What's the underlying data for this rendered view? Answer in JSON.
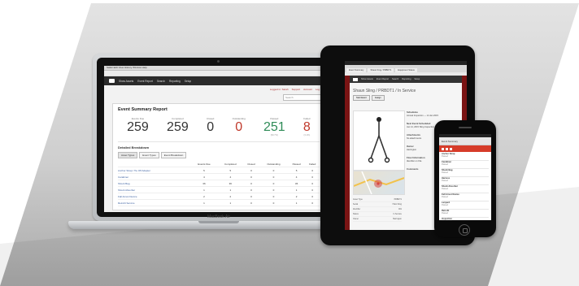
{
  "laptop": {
    "menubar": "Safari  Edit  View  History  Window  Help",
    "nav": {
      "items": [
        "Show Assets",
        "Event Report",
        "Search",
        "Reporting",
        "Setup"
      ]
    },
    "subnav": [
      "Logged in: Sarah",
      "Support",
      "Account",
      "Log out"
    ],
    "search_placeholder": "Search",
    "report": {
      "title": "Event Summary Report",
      "stats": [
        {
          "label": "Events Due",
          "value": "259",
          "note": "",
          "color": "#333333"
        },
        {
          "label": "Completed",
          "value": "259",
          "note": "",
          "color": "#333333"
        },
        {
          "label": "Closed",
          "value": "0",
          "note": "",
          "color": "#333333"
        },
        {
          "label": "Outstanding",
          "value": "0",
          "note": "",
          "color": "#c0392b"
        },
        {
          "label": "Passed",
          "value": "251",
          "note": "(99.7%)",
          "color": "#2e8b57"
        },
        {
          "label": "Failed",
          "value": "8",
          "note": "(3.1%)",
          "color": "#c0392b"
        }
      ],
      "breakdown": {
        "title": "Detailed Breakdown",
        "tabs": [
          "Asset Types",
          "Event Types",
          "Event Breakdown"
        ],
        "columns": [
          "",
          "Events Due",
          "Completed",
          "Closed",
          "Outstanding",
          "Passed",
          "Failed"
        ],
        "rows": [
          [
            "Anchor Strap / Tie Off Adapter",
            "5",
            "5",
            "0",
            "0",
            "5",
            "0"
          ],
          [
            "Carabiner",
            "4",
            "4",
            "0",
            "0",
            "4",
            "0"
          ],
          [
            "Shock Bag",
            "36",
            "36",
            "0",
            "0",
            "36",
            "0"
          ],
          [
            "Shock Absorber",
            "1",
            "1",
            "0",
            "0",
            "1",
            "0"
          ],
          [
            "Fall Arrest Device",
            "2",
            "2",
            "0",
            "0",
            "2",
            "0"
          ],
          [
            "Retrofit Service",
            "1",
            "1",
            "0",
            "0",
            "1",
            "0"
          ]
        ]
      }
    },
    "brand": "MacBook Air"
  },
  "tablet": {
    "tabs": [
      "Event Summary",
      "Shaun King / PRBDT1",
      "Equipment Status"
    ],
    "nav": [
      "Show Assets",
      "Event Report",
      "Search",
      "Reporting",
      "Setup"
    ],
    "title": "Shaun Sling / PRBDT1 / In Service",
    "buttons": [
      "Start Event",
      "Assign"
    ],
    "right": [
      {
        "title": "Schedules",
        "text": "Annual Inspection — 14 Jan 2015"
      },
      {
        "title": "Next Event Scheduled",
        "text": "Jan 14, 2015 Sling Inspection"
      },
      {
        "title": "Attachments",
        "text": "No attachments"
      },
      {
        "title": "Owner",
        "text": "Harrington"
      },
      {
        "title": "Flow Information",
        "text": "Identifier on File"
      },
      {
        "title": "Comments",
        "text": ""
      }
    ],
    "details": [
      [
        "Asset Type",
        "PRBDT1"
      ],
      [
        "Serial",
        "Hoist Sling"
      ],
      [
        "Identifier",
        "001"
      ],
      [
        "Status",
        "In Service"
      ],
      [
        "Owner",
        "Harrington"
      ]
    ]
  },
  "phone": {
    "header": "Event Summary",
    "items": [
      {
        "title": "Anchor Strap",
        "value": "Passed"
      },
      {
        "title": "Carabiner",
        "value": "Passed"
      },
      {
        "title": "Shock Bag",
        "value": "Passed"
      },
      {
        "title": "Harness",
        "value": "Passed"
      },
      {
        "title": "Shock Absorber",
        "value": "Passed"
      },
      {
        "title": "Fall Arrest Device",
        "value": "Passed"
      },
      {
        "title": "Lanyard",
        "value": "Passed"
      },
      {
        "title": "Retrofit",
        "value": "Passed"
      },
      {
        "title": "Inspection",
        "value": "Passed"
      }
    ]
  }
}
